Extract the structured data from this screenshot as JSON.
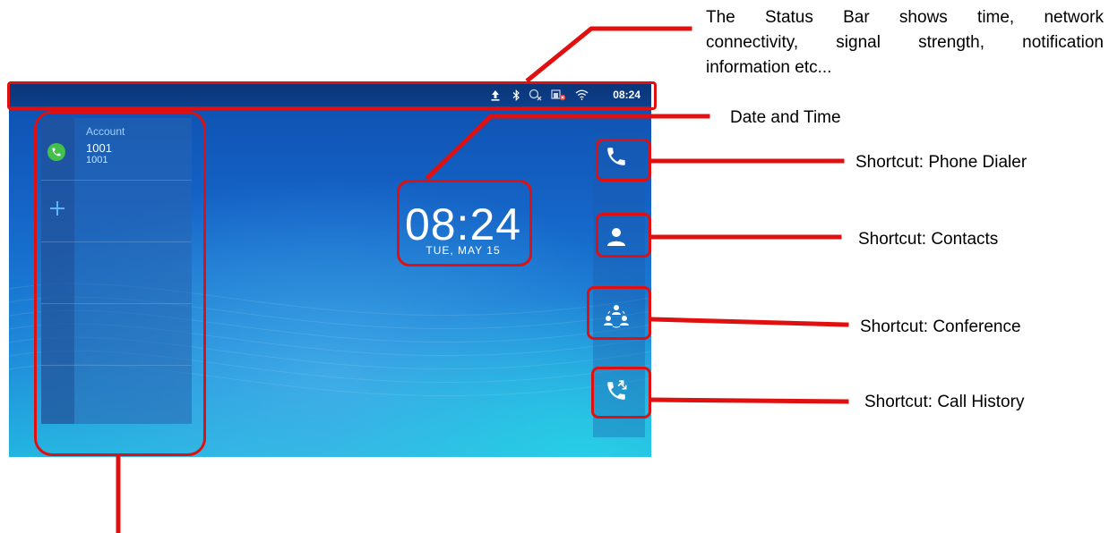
{
  "status_bar": {
    "time": "08:24",
    "icons": [
      "upload-icon",
      "bluetooth-icon",
      "no-sim-icon",
      "network-error-icon",
      "wifi-icon"
    ]
  },
  "account_panel": {
    "title": "Account",
    "name": "1001",
    "number": "1001"
  },
  "clock": {
    "time": "08:24",
    "date": "TUE, MAY 15"
  },
  "shortcuts": [
    "phone-dialer-icon",
    "contacts-icon",
    "conference-icon",
    "call-history-icon"
  ],
  "callouts": {
    "status_bar": "The Status Bar shows time, network connectivity, signal strength, notification information etc...",
    "status_bar_lines": [
      "The Status Bar shows time, network",
      "connectivity, signal strength, notification",
      "information etc..."
    ],
    "date_time": "Date and Time",
    "phone_dialer": "Shortcut: Phone Dialer",
    "contacts": "Shortcut: Contacts",
    "conference": "Shortcut: Conference",
    "call_history": "Shortcut: Call History"
  },
  "colors": {
    "annotation_red": "#e01010",
    "call_green": "#43c14a",
    "account_title_blue": "#9fd0ff"
  }
}
